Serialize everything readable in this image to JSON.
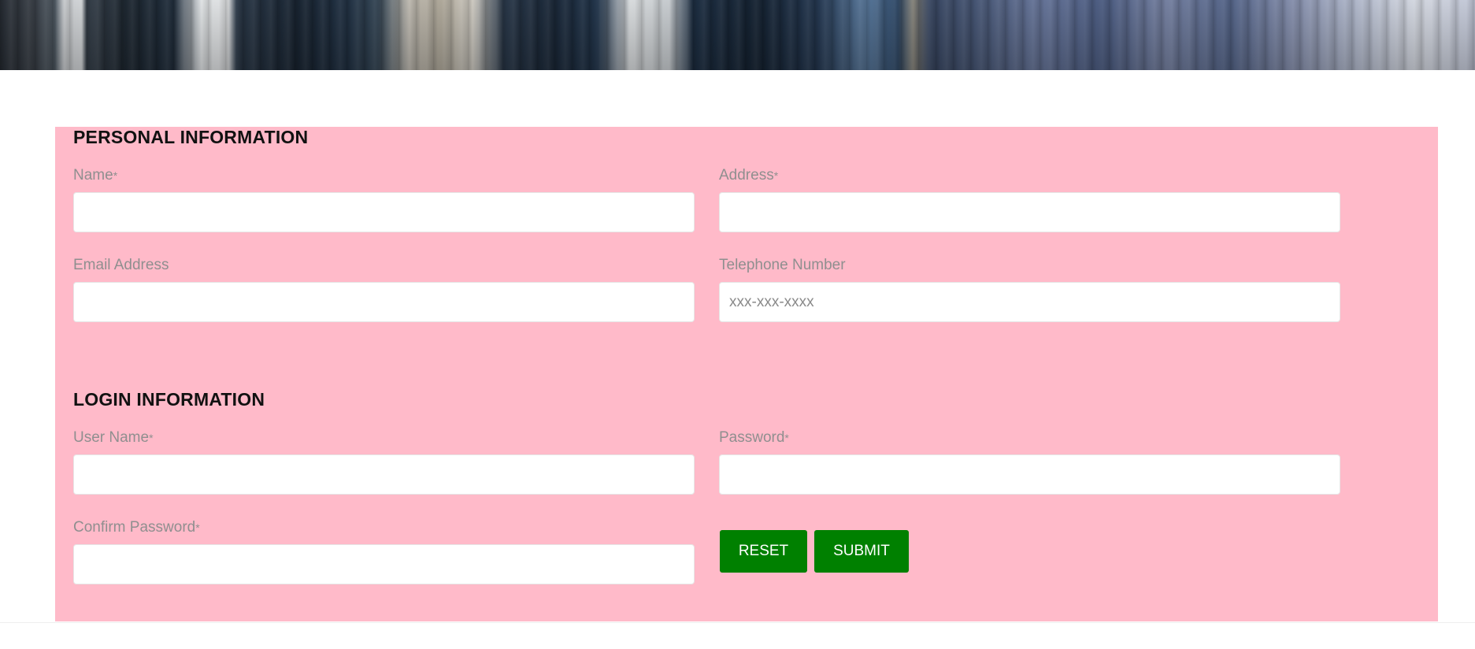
{
  "personal": {
    "title": "PERSONAL INFORMATION",
    "name_label": "Name",
    "address_label": "Address",
    "email_label": "Email Address",
    "phone_label": "Telephone Number",
    "phone_placeholder": "xxx-xxx-xxxx",
    "required_mark": "*"
  },
  "login": {
    "title": "LOGIN INFORMATION",
    "username_label": "User Name",
    "password_label": "Password",
    "confirm_label": "Confirm Password",
    "required_mark": "*"
  },
  "actions": {
    "reset_label": "RESET",
    "submit_label": "SUBMIT"
  },
  "colors": {
    "panel_background": "#ffbac9",
    "button_background": "#008000",
    "label_color": "#8f8f8f"
  }
}
